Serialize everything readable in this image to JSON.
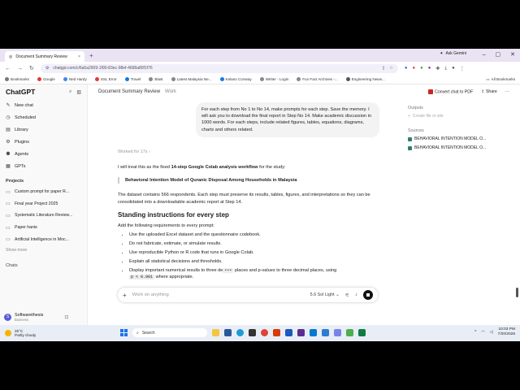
{
  "browser": {
    "tab_title": "Document Summary Review",
    "tab_close": "×",
    "new_tab": "+",
    "gemini_label": "Ask Gemini",
    "url": "chatgpt.com/c/6a5a2909-1f90-83ec-98ef-4668a80f1f76",
    "bookmarks": [
      "Bookmarks",
      "Google",
      "Ned Hardy",
      "SSL Error",
      "Travel",
      "Blast",
      "Latest Malaysia Ne...",
      "Kelano Conway",
      "iWriter - Login",
      "Fun Fact Archives -...",
      "Engineering News..."
    ],
    "all_bookmarks": "All Bookmarks"
  },
  "sidebar": {
    "brand": "ChatGPT",
    "items": [
      {
        "label": "New chat",
        "icon": "edit-icon"
      },
      {
        "label": "Scheduled",
        "icon": "clock-icon"
      },
      {
        "label": "Library",
        "icon": "library-icon"
      },
      {
        "label": "Plugins",
        "icon": "plugin-icon"
      },
      {
        "label": "Agents",
        "icon": "agent-icon"
      },
      {
        "label": "GPTs",
        "icon": "gpts-icon"
      }
    ],
    "projects_heading": "Projects",
    "projects": [
      "Custom prompt for paper R...",
      "Final year Project 2025",
      "Systematic Literature Review...",
      "Paper hanie",
      "Artificial Intelligence in Moc..."
    ],
    "show_more": "Show more",
    "chats_heading": "Chats",
    "workspace_name": "Softwarethesis",
    "workspace_plan": "Business",
    "invite_label": "Invite team members"
  },
  "header": {
    "title": "Document Summary Review",
    "mode": "Work",
    "convert_label": "Convert chat to PDF",
    "share_label": "Share",
    "more": "···"
  },
  "conversation": {
    "user_message": "For each step from No 1 to No 14, make prompts for each step. Save the memory. I will ask you to download the final report in Step No 14. Make academic discussion in 1000 words. For each steps, include related figures, tables, equations, diagrams, charts and others related.",
    "thought": "Worked for 17s ›",
    "intro_a": "I will treat this as the fixed ",
    "intro_bold": "14-step Google Colab analysis workflow",
    "intro_b": " for the study:",
    "quote": "Behavioral Intention Model of Quranic Disposal Among Households in Malaysia",
    "para2": "The dataset contains 566 respondents. Each step must preserve its results, tables, figures, and interpretations so they can be consolidated into a downloadable academic report at Step 14.",
    "heading": "Standing instructions for every step",
    "list_intro": "Add the following requirements to every prompt:",
    "bullets": [
      "Use the uploaded Excel dataset and the questionnaire codebook.",
      "Do not fabricate, estimate, or simulate results.",
      "Use reproducible Python or R code that runs in Google Colab.",
      "Explain all statistical decisions and thresholds."
    ],
    "last_bullet_a": "Display important numerical results to three de",
    "last_bullet_pill": "•••",
    "last_bullet_b": " places and p-values to three decimal places, using",
    "last_bullet_code": "p < 0.001",
    "last_bullet_c": " where appropriate."
  },
  "composer": {
    "placeholder": "Work on anything",
    "model": "5.6 Sol Light ⌄"
  },
  "right_panel": {
    "outputs_heading": "Outputs",
    "create_label": "Create file or site",
    "sources_heading": "Sources",
    "sources": [
      "BEHAVIORAL INTENTION MODEL O...",
      "BEHAVIORAL INTENTION MODEL O..."
    ]
  },
  "taskbar": {
    "temp": "25°C",
    "weather": "Partly cloudy",
    "search": "Search",
    "time": "10:03 PM",
    "date": "7/20/2026"
  }
}
